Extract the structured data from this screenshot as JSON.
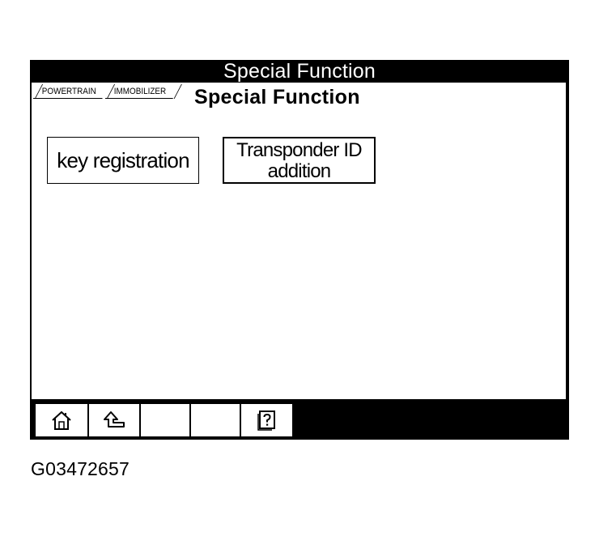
{
  "window": {
    "title": "Special Function"
  },
  "breadcrumb": {
    "items": [
      {
        "label": "POWERTRAIN"
      },
      {
        "label": "IMMOBILIZER"
      }
    ]
  },
  "page": {
    "title": "Special Function"
  },
  "functions": [
    {
      "label": "key registration"
    },
    {
      "label_line1": "Transponder ID",
      "label_line2": "addition"
    }
  ],
  "toolbar": {
    "buttons": [
      {
        "icon": "home-icon"
      },
      {
        "icon": "back-icon"
      },
      {
        "icon": ""
      },
      {
        "icon": ""
      },
      {
        "icon": "help-icon"
      }
    ]
  },
  "figure": {
    "caption": "G03472657"
  }
}
